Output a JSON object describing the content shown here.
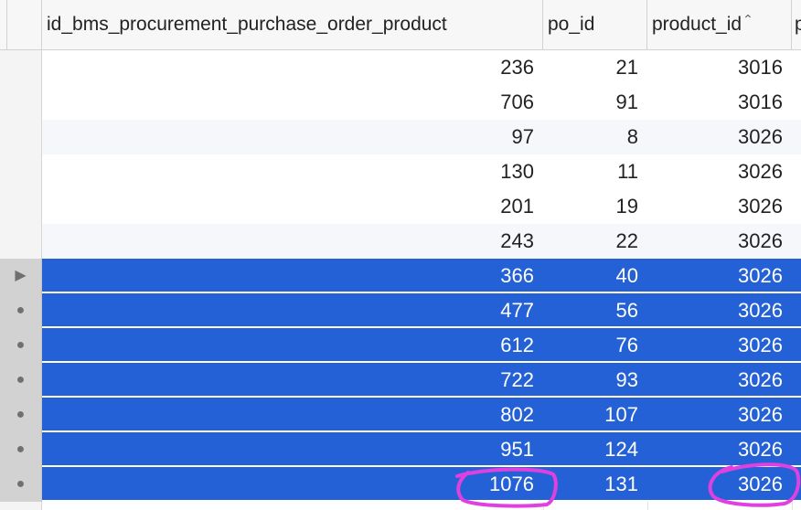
{
  "columns": [
    {
      "label": "id_bms_procurement_purchase_order_product"
    },
    {
      "label": "po_id"
    },
    {
      "label": "product_id",
      "sort_icon": "chevron-up-icon"
    },
    {
      "label": "p"
    }
  ],
  "rows": [
    {
      "values": [
        "236",
        "21",
        "3016"
      ],
      "selected": false,
      "marker": ""
    },
    {
      "values": [
        "706",
        "91",
        "3016"
      ],
      "selected": false,
      "marker": ""
    },
    {
      "values": [
        "97",
        "8",
        "3026"
      ],
      "selected": false,
      "marker": ""
    },
    {
      "values": [
        "130",
        "11",
        "3026"
      ],
      "selected": false,
      "marker": ""
    },
    {
      "values": [
        "201",
        "19",
        "3026"
      ],
      "selected": false,
      "marker": ""
    },
    {
      "values": [
        "243",
        "22",
        "3026"
      ],
      "selected": false,
      "marker": ""
    },
    {
      "values": [
        "366",
        "40",
        "3026"
      ],
      "selected": true,
      "marker": "▶"
    },
    {
      "values": [
        "477",
        "56",
        "3026"
      ],
      "selected": true,
      "marker": "●"
    },
    {
      "values": [
        "612",
        "76",
        "3026"
      ],
      "selected": true,
      "marker": "●"
    },
    {
      "values": [
        "722",
        "93",
        "3026"
      ],
      "selected": true,
      "marker": "●"
    },
    {
      "values": [
        "802",
        "107",
        "3026"
      ],
      "selected": true,
      "marker": "●"
    },
    {
      "values": [
        "951",
        "124",
        "3026"
      ],
      "selected": true,
      "marker": "●"
    },
    {
      "values": [
        "1076",
        "131",
        "3026"
      ],
      "selected": true,
      "marker": "●"
    }
  ],
  "colors": {
    "selection": "#2561d6",
    "annotation": "#e040e0"
  }
}
